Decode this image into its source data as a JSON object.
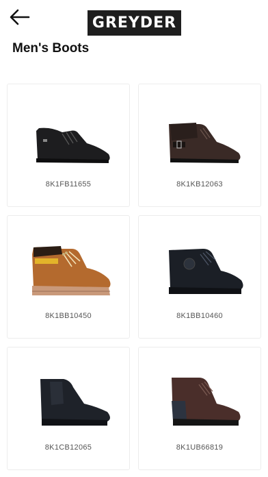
{
  "header": {
    "back_icon": "arrow-left-icon",
    "brand": "GREYDER"
  },
  "page": {
    "title": "Men's Boots"
  },
  "products": [
    {
      "code": "8K1FB11655",
      "image": "black-leather-lace-up-boot"
    },
    {
      "code": "8K1KB12063",
      "image": "brown-ankle-boot-with-buckle"
    },
    {
      "code": "8K1BB10450",
      "image": "tan-work-boot"
    },
    {
      "code": "8K1BB10460",
      "image": "black-high-lace-up-boot"
    },
    {
      "code": "8K1CB12065",
      "image": "black-chelsea-boot"
    },
    {
      "code": "8K1UB66819",
      "image": "brown-zip-lace-up-boot"
    }
  ]
}
